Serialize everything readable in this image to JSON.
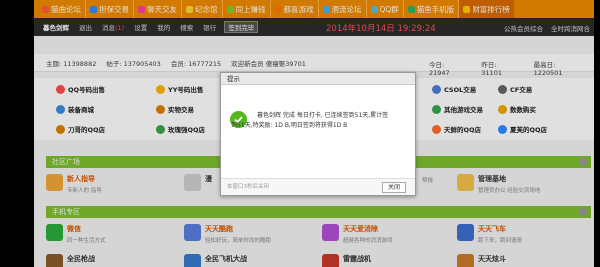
{
  "topnav": [
    {
      "label": "猫曲论坛",
      "color": "#ff5e3a"
    },
    {
      "label": "担保交易",
      "color": "#2d8bff"
    },
    {
      "label": "聊天交友",
      "color": "#ff3fa4"
    },
    {
      "label": "纪念馆",
      "color": "#ffd43b"
    },
    {
      "label": "同上赚钱",
      "color": "#7ad03a"
    },
    {
      "label": "都喜游戏",
      "color": "#ff7a00"
    },
    {
      "label": "酒流论坛",
      "color": "#38b6ff"
    },
    {
      "label": "QQ群",
      "color": "#5bc0de"
    },
    {
      "label": "猫鱼手机版",
      "color": "#29b765"
    },
    {
      "label": "财富排行榜",
      "color": "#ffcd00"
    }
  ],
  "userbar": {
    "username": "暮色剑辉",
    "logout": "退出",
    "messages": "消息",
    "msg_count": "(1)",
    "settings": "设置",
    "mine": "我的",
    "search": "搜索",
    "bank": "银行",
    "checkin": "签到完毕",
    "datetime": "2014年10月14日 19:29:24",
    "public_info": "公热会员综合",
    "right_link": "全时跨消网合"
  },
  "stats": {
    "posts": "主题: 11398882",
    "replies": "帖子: 137905403",
    "members": "会员: 16777215",
    "welcome": "欢迎新会员 傻瘦娶39701",
    "today": "今日: 21947",
    "yesterday": "昨日: 31101",
    "max": "最高日: 1220501"
  },
  "quick": [
    {
      "label": "QQ号码出售",
      "color": "#ff4d4d"
    },
    {
      "label": "YY号码出售",
      "color": "#ffb400"
    },
    {
      "label": "CSOL交易",
      "color": "#4d7fd6"
    },
    {
      "label": "CF交易",
      "color": "#666"
    },
    {
      "label": "装备商城",
      "color": "#3b8ddb"
    },
    {
      "label": "实物交易",
      "color": "#e08000"
    },
    {
      "label": "其他游戏交易",
      "color": "#33a852"
    },
    {
      "label": "数数购买",
      "color": "#f0a800"
    },
    {
      "label": "刀哥的QQ店",
      "color": "#e08000"
    },
    {
      "label": "玫瑰强QQ店",
      "color": "#3fa34d"
    },
    {
      "label": "天鲜的QQ店",
      "color": "#ff6a2a"
    },
    {
      "label": "夏芙的QQ店",
      "color": "#2d8bff"
    }
  ],
  "sections": {
    "social": "社区广场",
    "mobile": "手机专区"
  },
  "social_cards": [
    {
      "title": "新人指导",
      "desc": "专新人的 指导",
      "color": "#f2a83a"
    },
    {
      "title": "漫",
      "desc": "",
      "color": "#cfcfcf"
    },
    {
      "title": "",
      "desc": "帮报",
      "color": "#e0e0e0"
    },
    {
      "title": "管理基地",
      "desc": "管理员办公 经验交流场地",
      "color": "#f5c24c"
    }
  ],
  "mobile_cards": [
    {
      "title": "微信",
      "desc": "同一种生活方式",
      "color": "#2aae3c"
    },
    {
      "title": "天天酷跑",
      "desc": "轻松好玩，简单时尚的酷跑",
      "color": "#5a7fe0"
    },
    {
      "title": "天天爱消除",
      "desc": "超越各种的消消游戏",
      "color": "#b24fd6"
    },
    {
      "title": "天天飞车",
      "desc": "跑下来，跑到速速",
      "color": "#3d6fd0"
    },
    {
      "title": "全民枪战",
      "desc": "",
      "color": "#8a5a2a"
    },
    {
      "title": "全民飞机大战",
      "desc": "",
      "color": "#3a7acc"
    },
    {
      "title": "雷霆战机",
      "desc": "",
      "color": "#c83a2a"
    },
    {
      "title": "天天炫斗",
      "desc": "",
      "color": "#d07a2a"
    }
  ],
  "dialog": {
    "title": "提示",
    "message_line1": "暮色剑辉 完成 每日打卡, 已连续签到51天,累计签",
    "message_line2": "到51天,特奖励: 1D B,明日签到将获得1D B",
    "footer": "本窗口3秒后关闭",
    "close": "关闭"
  }
}
